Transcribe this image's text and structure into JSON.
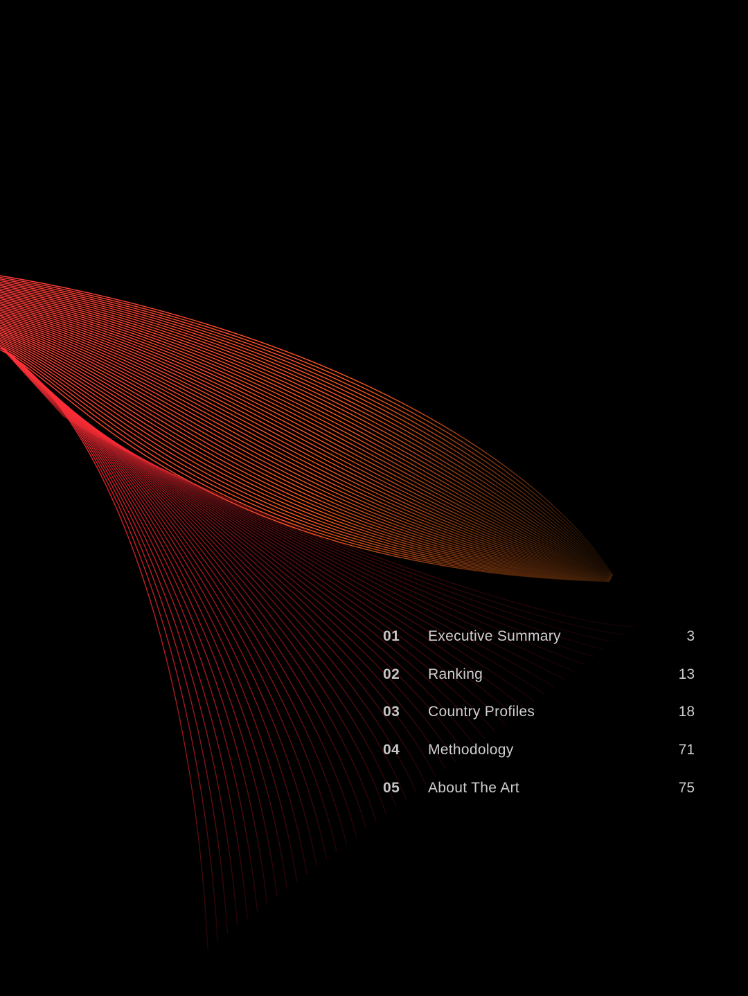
{
  "artwork": {
    "name": "red-orange wave line art",
    "colors": {
      "red": "#ff3038",
      "orange": "#ff7a1c",
      "background": "#000000"
    }
  },
  "toc": {
    "items": [
      {
        "number": "01",
        "title": "Executive Summary",
        "page": "3"
      },
      {
        "number": "02",
        "title": "Ranking",
        "page": "13"
      },
      {
        "number": "03",
        "title": "Country Profiles",
        "page": "18"
      },
      {
        "number": "04",
        "title": "Methodology",
        "page": "71"
      },
      {
        "number": "05",
        "title": "About The Art",
        "page": "75"
      }
    ]
  }
}
